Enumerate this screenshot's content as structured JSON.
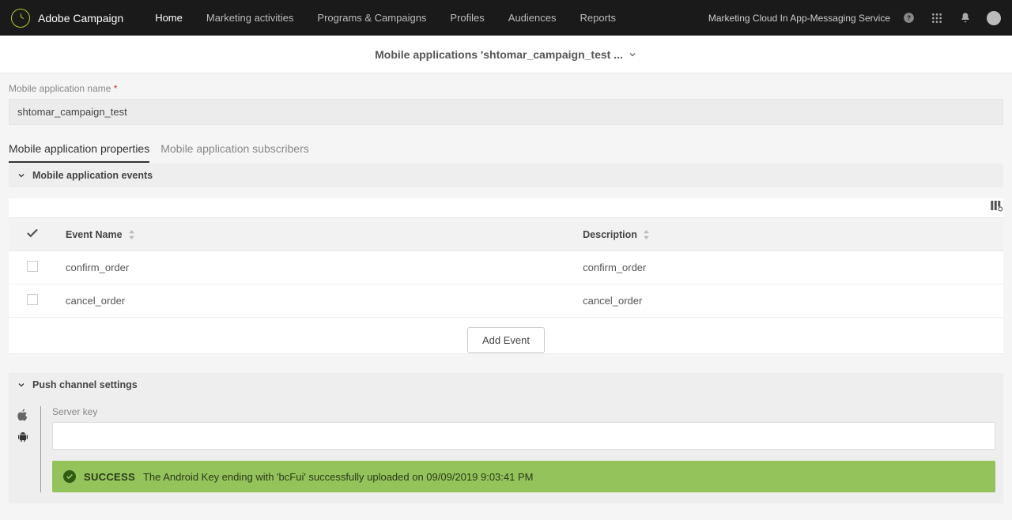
{
  "topbar": {
    "brand": "Adobe Campaign",
    "nav": [
      "Home",
      "Marketing activities",
      "Programs & Campaigns",
      "Profiles",
      "Audiences",
      "Reports"
    ],
    "tenant": "Marketing Cloud In App-Messaging Service"
  },
  "subheader": {
    "title": "Mobile applications 'shtomar_campaign_test ..."
  },
  "nameField": {
    "label": "Mobile application name",
    "value": "shtomar_campaign_test"
  },
  "tabs": {
    "t0": "Mobile application properties",
    "t1": "Mobile application subscribers"
  },
  "events": {
    "section": "Mobile application events",
    "col0": "Event Name",
    "col1": "Description",
    "rows": [
      {
        "name": "confirm_order",
        "desc": "confirm_order"
      },
      {
        "name": "cancel_order",
        "desc": "cancel_order"
      }
    ],
    "addBtn": "Add Event"
  },
  "push": {
    "section": "Push channel settings",
    "serverKeyLabel": "Server key",
    "serverKeyValue": "",
    "alertTitle": "SUCCESS",
    "alertMsg": "The Android Key ending with 'bcFui' successfully uploaded on 09/09/2019 9:03:41 PM"
  }
}
